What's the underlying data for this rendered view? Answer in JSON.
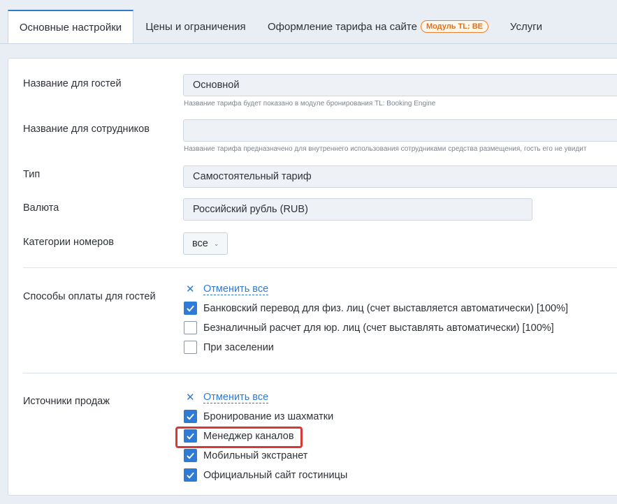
{
  "tabs": [
    {
      "label": "Основные настройки",
      "active": true
    },
    {
      "label": "Цены и ограничения"
    },
    {
      "label": "Оформление тарифа на сайте",
      "badge": "Модуль TL: BE"
    },
    {
      "label": "Услуги"
    }
  ],
  "form": {
    "guest_name": {
      "label": "Название для гостей",
      "value": "Основной",
      "hint": "Название тарифа будет показано в модуле бронирования TL: Booking Engine"
    },
    "staff_name": {
      "label": "Название для сотрудников",
      "value": "",
      "hint": "Название тарифа предназначено для внутреннего использования сотрудниками средства размещения, гость его не увидит"
    },
    "type": {
      "label": "Тип",
      "value": "Самостоятельный тариф"
    },
    "currency": {
      "label": "Валюта",
      "value": "Российский рубль (RUB)"
    },
    "room_categories": {
      "label": "Категории номеров",
      "value": "все"
    }
  },
  "payment_methods": {
    "label": "Способы оплаты для гостей",
    "cancel_all": "Отменить все",
    "items": [
      {
        "label": "Банковский перевод для физ. лиц (счет выставляется автоматически) [100%]",
        "checked": true
      },
      {
        "label": "Безналичный расчет для юр. лиц (счет выставлять автоматически) [100%]",
        "checked": false
      },
      {
        "label": "При заселении",
        "checked": false
      }
    ]
  },
  "sales_sources": {
    "label": "Источники продаж",
    "cancel_all": "Отменить все",
    "items": [
      {
        "label": "Бронирование из шахматки",
        "checked": true
      },
      {
        "label": "Менеджер каналов",
        "checked": true
      },
      {
        "label": "Мобильный экстранет",
        "checked": true
      },
      {
        "label": "Официальный сайт гостиницы",
        "checked": true
      }
    ]
  },
  "colors": {
    "accent": "#2e7bd6",
    "badge": "#e0701d",
    "highlight": "#d93838"
  }
}
